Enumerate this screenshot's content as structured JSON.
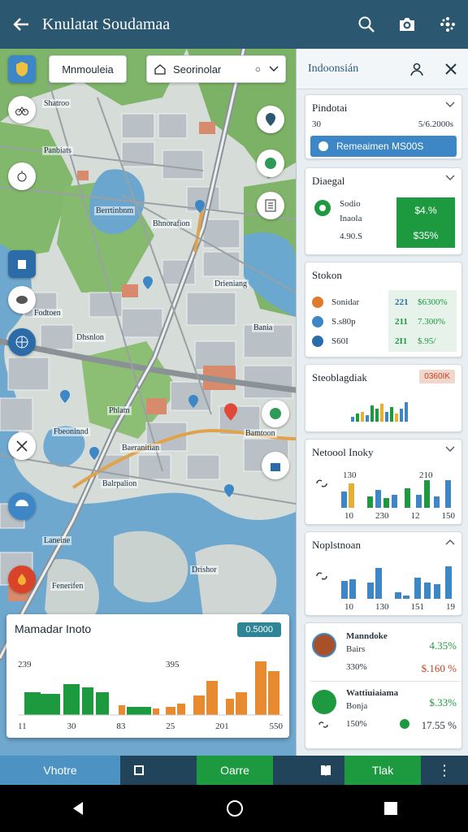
{
  "header": {
    "title": "Knulatat Soudamaa"
  },
  "map": {
    "search_left": "Mnmouleia",
    "search_right": "Seorinolar",
    "labels": [
      "Shatroo",
      "Panbiats",
      "Berrtinbnm",
      "Bhnorafion",
      "Drieniang",
      "Fodtoen",
      "Bania",
      "Dhsnlon",
      "Phlam",
      "Fbeoninnd",
      "Baeranitian",
      "Bamtoon",
      "Balrpalion",
      "Laneine",
      "Fenerifen",
      "Drishor"
    ],
    "card": {
      "title": "Mamadar Inoto",
      "badge": "0.5000",
      "ticks_top": [
        "239",
        "395"
      ],
      "ticks_bottom": [
        "11",
        "30",
        "83",
        "25",
        "201",
        "550"
      ]
    }
  },
  "panel": {
    "title": "Indoonsián",
    "cards": [
      {
        "title": "Pindotai",
        "left": "30",
        "right": "5/6.2000s",
        "button": "Remeaimen  MS00S"
      },
      {
        "title": "Diaegal",
        "l1": "Sodio",
        "l2": "Inaola",
        "l3": "4.90.S",
        "v1": "$4.%",
        "v2": "$35%"
      },
      {
        "title": "Stokon",
        "rows": [
          {
            "label": "Sonidar",
            "a": "221",
            "b": "$6300%"
          },
          {
            "label": "S.s80p",
            "a": "211",
            "b": "7.300%"
          },
          {
            "label": "S60I",
            "a": "2I1",
            "b": "$.95/"
          }
        ]
      },
      {
        "title": "Steoblagdiak",
        "badge": "0360IK"
      },
      {
        "title": "Netoool Inoky",
        "ticks": [
          "10",
          "230",
          "12",
          "150"
        ],
        "axis_top": [
          "130",
          "210"
        ]
      },
      {
        "title": "Noplstnoan",
        "ticks": [
          "10",
          "130",
          "151",
          "19"
        ]
      },
      {
        "title": "",
        "rows": [
          {
            "name": "Manndoke",
            "sub": "Bairs",
            "val": "4.35%",
            "v2": "330%",
            "v3": "$.160 %"
          },
          {
            "name": "Wattiuiaiama",
            "sub": "Bonja",
            "val": "$.33%",
            "v2": "150%",
            "v3": "17.55 %"
          }
        ]
      }
    ]
  },
  "bottom_nav": [
    "Vhotre",
    "",
    "Oarre",
    "",
    "Tlak",
    "⋮"
  ],
  "colors": {
    "header": "#2b5870",
    "accent_blue": "#3d87c6",
    "green": "#1d9a3f",
    "orange": "#e88a30"
  }
}
